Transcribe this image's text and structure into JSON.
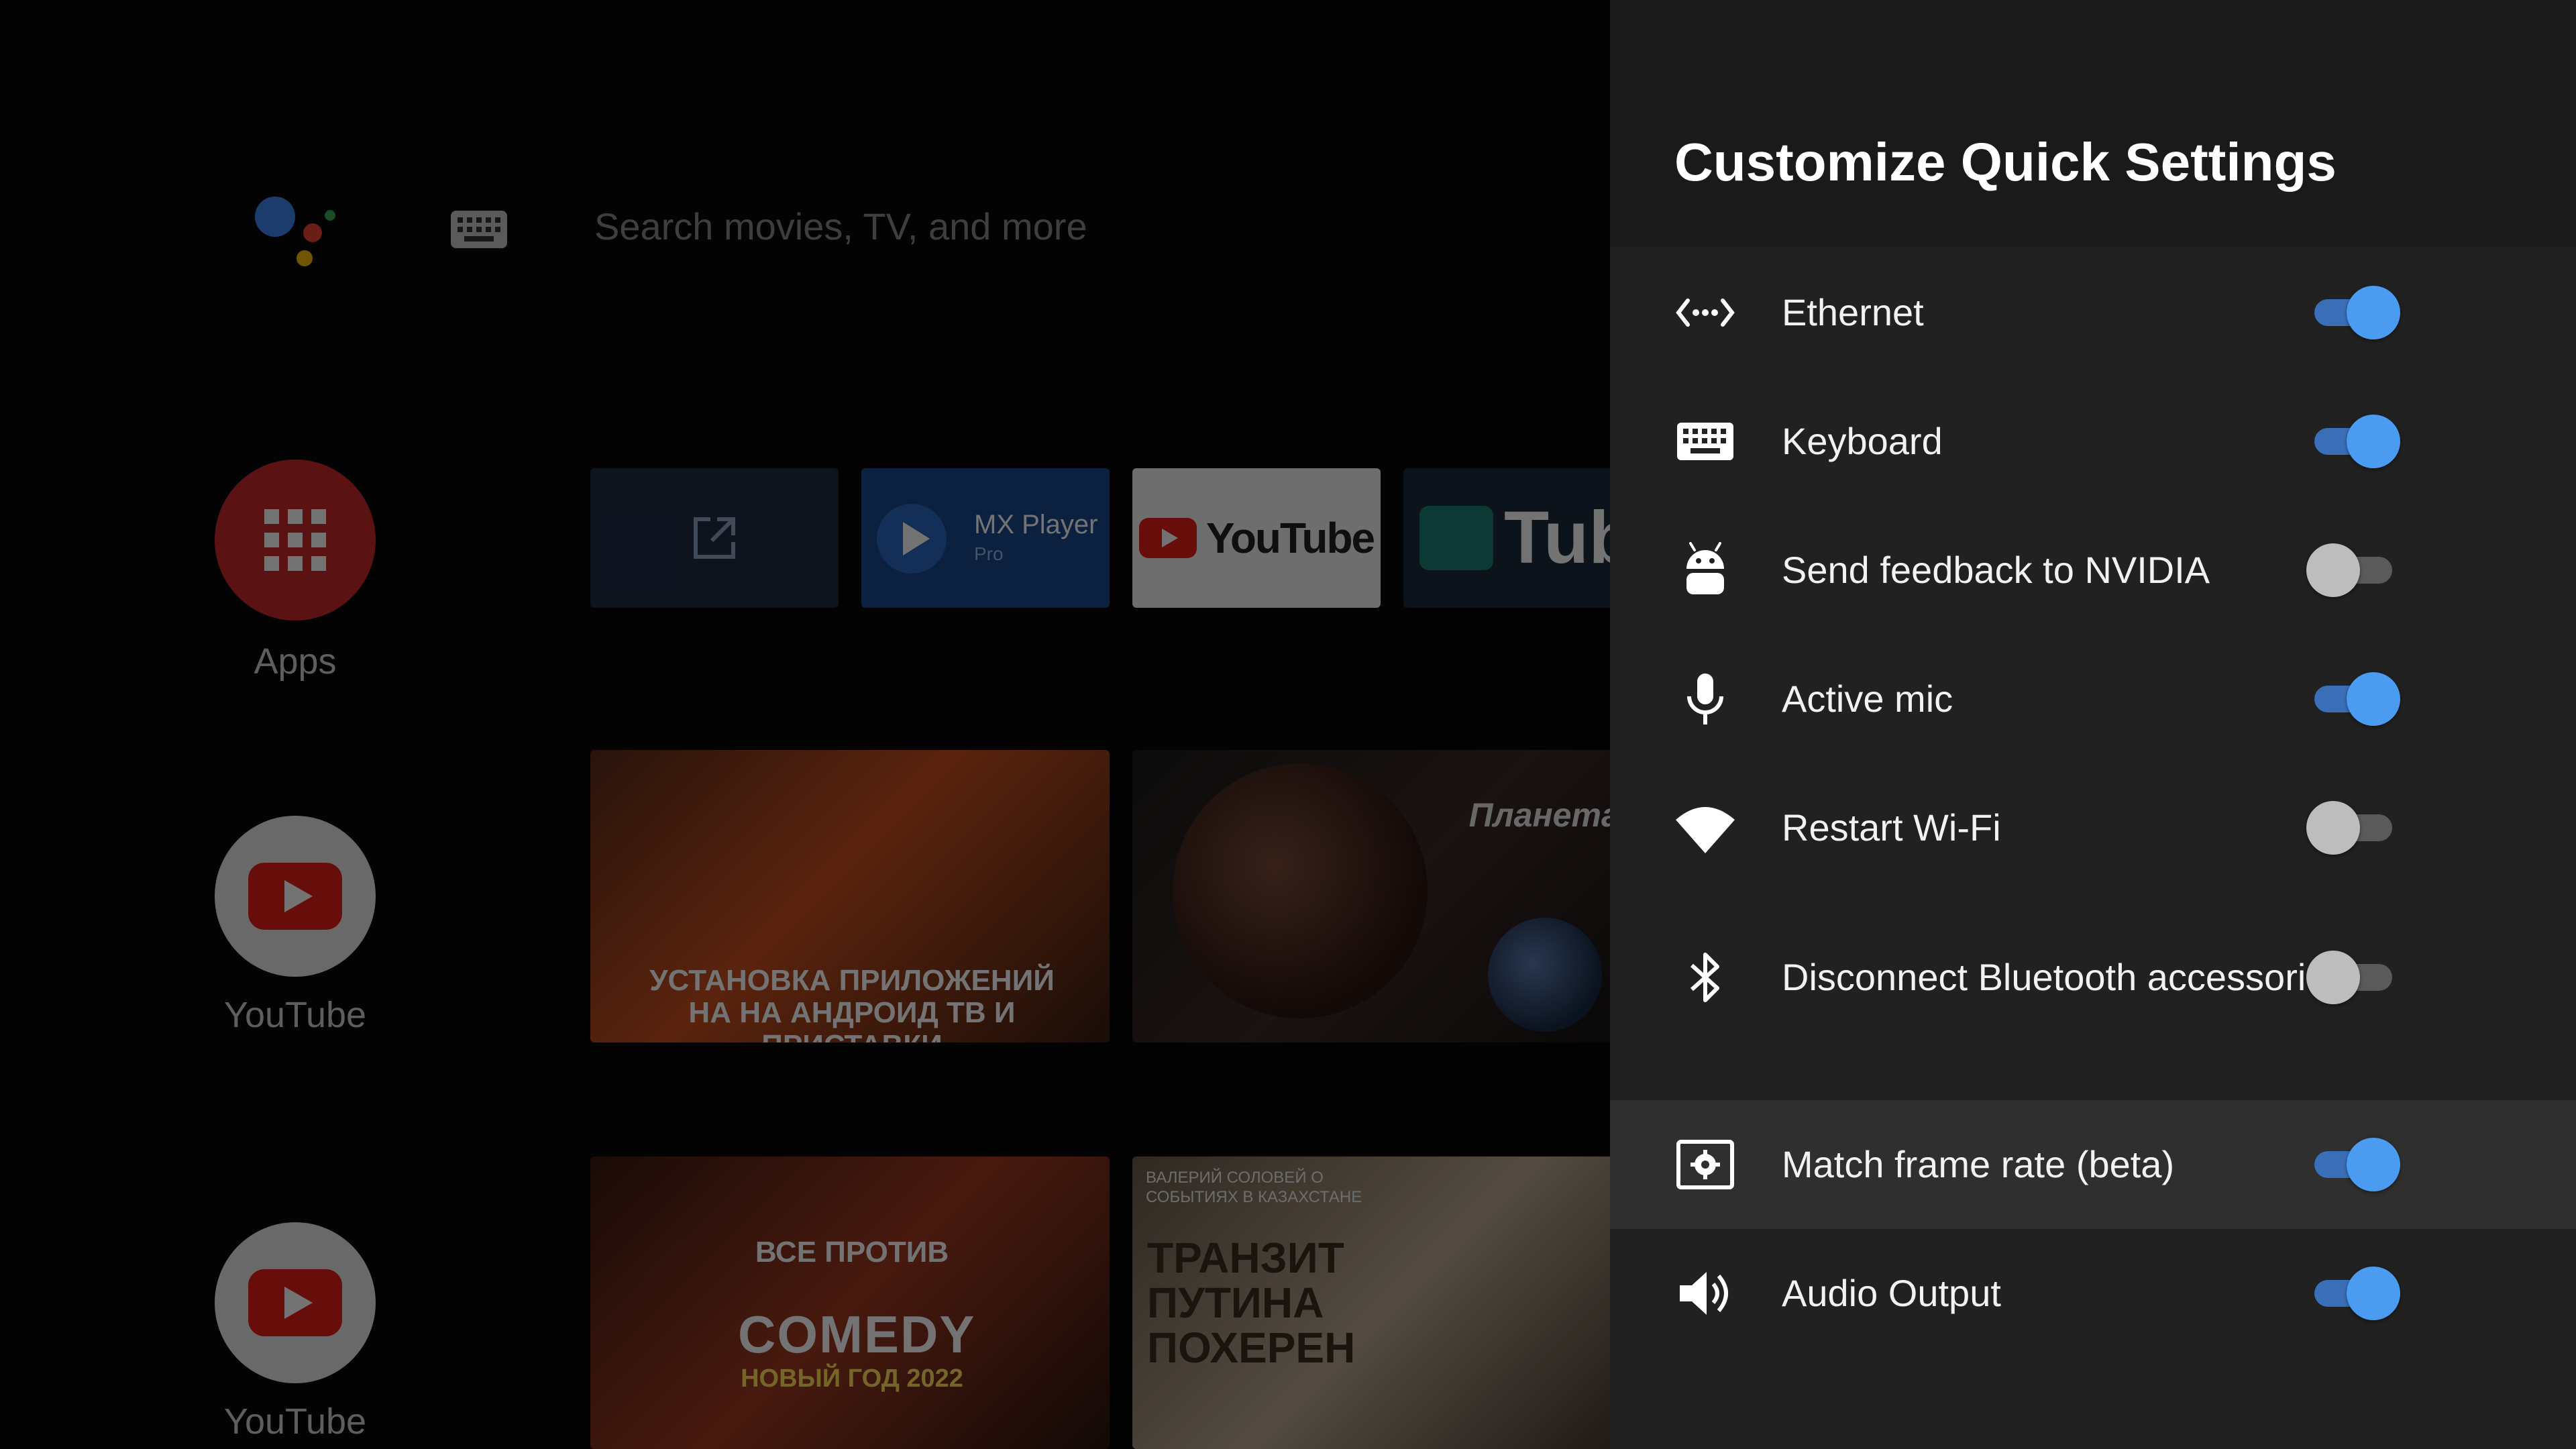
{
  "home": {
    "search_placeholder": "Search movies, TV, and more",
    "apps_label": "Apps",
    "youtube_label_1": "YouTube",
    "youtube_label_2": "YouTube",
    "tiles": {
      "mx_title": "MX Player",
      "mx_sub": "Pro",
      "youtube_logo": "YouTube",
      "stube_logo": "Tube"
    },
    "thumbs": {
      "t1_caption": "УСТАНОВКА ПРИЛОЖЕНИЙ НА НА АНДРОИД ТВ И ПРИСТАВКИ",
      "t2_caption": "Планета Х",
      "t3_caption": "ВСЕ ПРОТИВ",
      "t3_comedy": "COMEDY",
      "t3_sub": "НОВЫЙ ГОД 2022",
      "t4_top": "ВАЛЕРИЙ СОЛОВЕЙ О СОБЫТИЯХ В КАЗАХСТАНЕ",
      "t4_main": "ТРАНЗИТ ПУТИНА ПОХЕРЕН"
    }
  },
  "panel": {
    "title": "Customize Quick Settings",
    "items": [
      {
        "label": "Ethernet",
        "icon": "ethernet-icon",
        "enabled": true
      },
      {
        "label": "Keyboard",
        "icon": "keyboard-icon",
        "enabled": true
      },
      {
        "label": "Send feedback to NVIDIA",
        "icon": "android-icon",
        "enabled": false
      },
      {
        "label": "Active mic",
        "icon": "microphone-icon",
        "enabled": true
      },
      {
        "label": "Restart Wi-Fi",
        "icon": "wifi-icon",
        "enabled": false
      },
      {
        "label": "Disconnect Bluetooth accessories",
        "icon": "bluetooth-icon",
        "enabled": false
      },
      {
        "label": "Match frame rate (beta)",
        "icon": "frame-rate-icon",
        "enabled": true,
        "selected": true
      },
      {
        "label": "Audio Output",
        "icon": "speaker-icon",
        "enabled": true
      }
    ]
  },
  "colors": {
    "toggle_on": "#4b9bf1",
    "toggle_off": "#bdbdbd",
    "panel_bg": "#212121",
    "selected_row": "#2f2f2f"
  }
}
